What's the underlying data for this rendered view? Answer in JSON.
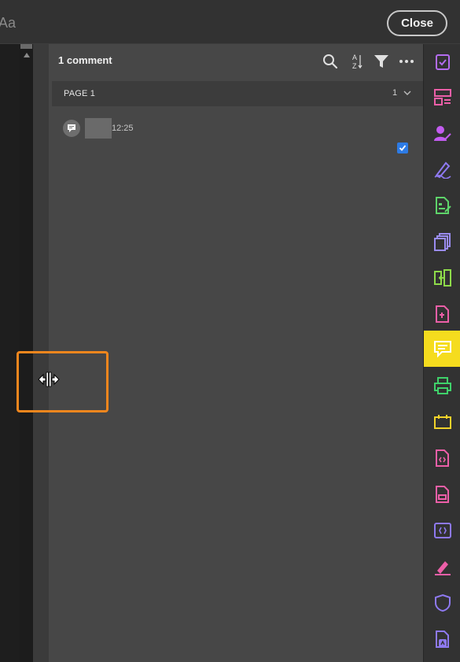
{
  "topbar": {
    "partial_text": "Aa",
    "close_label": "Close"
  },
  "panel": {
    "title": "1 comment",
    "tools": [
      "search-icon",
      "sort-az-icon",
      "filter-icon",
      "more-icon"
    ],
    "page_group": {
      "label": "PAGE 1",
      "count": "1"
    },
    "comments": [
      {
        "time": "12:25",
        "checked": true
      }
    ]
  },
  "rail": {
    "items": [
      {
        "name": "edit-pdf-icon",
        "color": "#b36cf0"
      },
      {
        "name": "organize-pages-icon",
        "color": "#ec5fa8"
      },
      {
        "name": "request-signatures-icon",
        "color": "#c35cf0"
      },
      {
        "name": "fill-sign-icon",
        "color": "#8e79f0"
      },
      {
        "name": "prepare-form-icon",
        "color": "#5ed46a"
      },
      {
        "name": "combine-files-icon",
        "color": "#9a8cf0"
      },
      {
        "name": "compare-files-icon",
        "color": "#8edb4a"
      },
      {
        "name": "create-pdf-icon",
        "color": "#ec5fa8"
      },
      {
        "name": "comment-icon",
        "color": "#ffffff",
        "active": true
      },
      {
        "name": "scan-ocr-icon",
        "color": "#3fd16a"
      },
      {
        "name": "measure-icon",
        "color": "#f0d22a"
      },
      {
        "name": "export-pdf-icon",
        "color": "#ec5fa8"
      },
      {
        "name": "redact-icon",
        "color": "#ec5fa8"
      },
      {
        "name": "javascript-icon",
        "color": "#8e79f0"
      },
      {
        "name": "sign-icon",
        "color": "#ec5fa8"
      },
      {
        "name": "protect-icon",
        "color": "#8e79f0"
      },
      {
        "name": "more-tools-icon",
        "color": "#8e79f0"
      }
    ]
  },
  "colors": {
    "highlight": "#f0861d",
    "active_tool": "#f5dc1e",
    "checkbox": "#2d7be5"
  }
}
